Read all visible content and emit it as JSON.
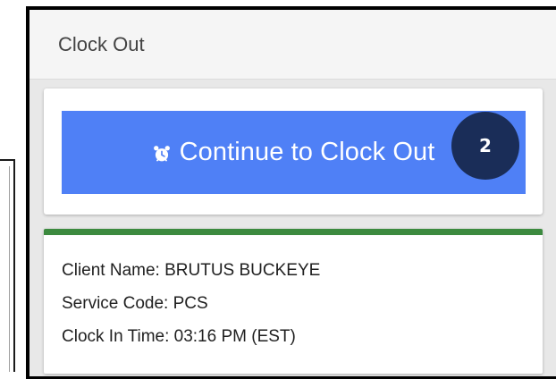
{
  "header": {
    "title": "Clock Out"
  },
  "action": {
    "button_label": "Continue to Clock Out",
    "button_icon": "alarm-clock-icon",
    "step_badge": "2"
  },
  "visit": {
    "client_name": "Client Name: BRUTUS BUCKEYE",
    "service_code": "Service Code: PCS",
    "clock_in_time": "Clock In Time: 03:16 PM (EST)"
  },
  "colors": {
    "button": "#4f80f6",
    "badge": "#1a2d58",
    "status_bar": "#3c8a3f"
  }
}
